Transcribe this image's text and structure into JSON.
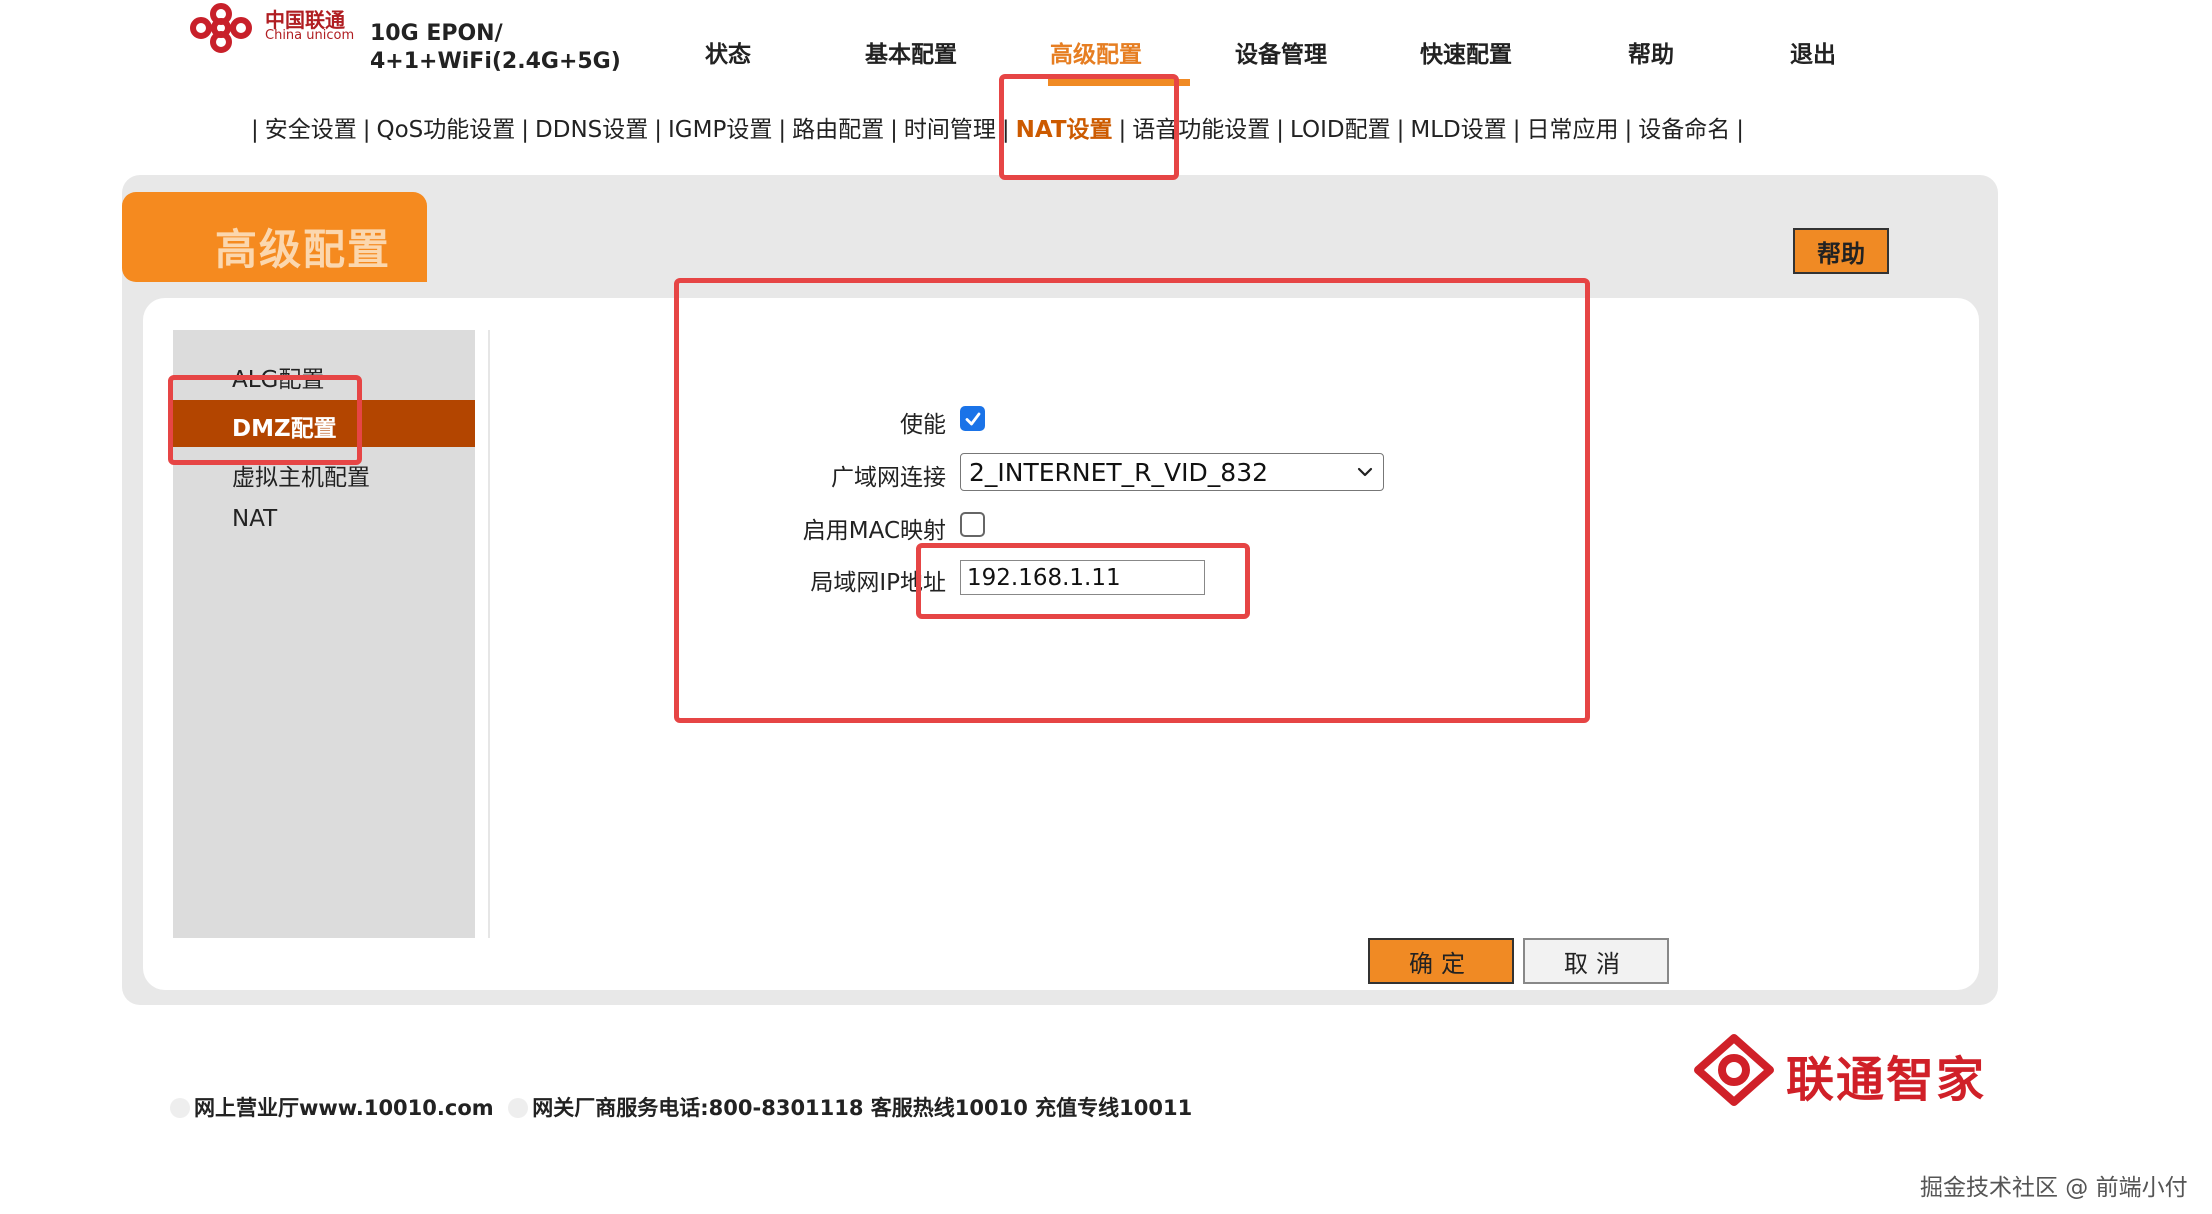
{
  "colors": {
    "accent_orange": "#f08a24",
    "active_nav": "#e67e22",
    "sidebar_active": "#b34500",
    "highlight_red": "#e64545",
    "brand_red": "#d02028"
  },
  "header": {
    "logo_cn": "中国联通",
    "logo_en": "China unicom",
    "model_line1": "10G EPON/",
    "model_line2": "4+1+WiFi(2.4G+5G)",
    "nav": [
      {
        "label": "状态"
      },
      {
        "label": "基本配置"
      },
      {
        "label": "高级配置"
      },
      {
        "label": "设备管理"
      },
      {
        "label": "快速配置"
      },
      {
        "label": "帮助"
      },
      {
        "label": "退出"
      }
    ],
    "active_nav": "高级配置"
  },
  "subnav": {
    "separator": "|",
    "items": [
      {
        "label": "安全设置"
      },
      {
        "label": "QoS功能设置"
      },
      {
        "label": "DDNS设置"
      },
      {
        "label": "IGMP设置"
      },
      {
        "label": "路由配置"
      },
      {
        "label": "时间管理"
      },
      {
        "label": "NAT设置"
      },
      {
        "label": "语音功能设置"
      },
      {
        "label": "LOID配置"
      },
      {
        "label": "MLD设置"
      },
      {
        "label": "日常应用"
      },
      {
        "label": "设备命名"
      }
    ],
    "active": "NAT设置"
  },
  "panel": {
    "title": "高级配置",
    "help_label": "帮助"
  },
  "sidebar": {
    "items": [
      {
        "label": "ALG配置"
      },
      {
        "label": "DMZ配置"
      },
      {
        "label": "虚拟主机配置"
      },
      {
        "label": "NAT"
      }
    ],
    "active": "DMZ配置"
  },
  "form": {
    "enable_label": "使能",
    "enable_checked": true,
    "wan_label": "广域网连接",
    "wan_value": "2_INTERNET_R_VID_832",
    "mac_label": "启用MAC映射",
    "mac_checked": false,
    "lan_ip_label": "局域网IP地址",
    "lan_ip_value": "192.168.1.11"
  },
  "actions": {
    "ok_label": "确定",
    "cancel_label": "取消"
  },
  "footer": {
    "hall_text": "网上营业厅www.10010.com",
    "service_text": "网关厂商服务电话:800-8301118 客服热线10010 充值专线10011",
    "brand_text": "联通智家"
  },
  "watermark": "掘金技术社区 @ 前端小付"
}
